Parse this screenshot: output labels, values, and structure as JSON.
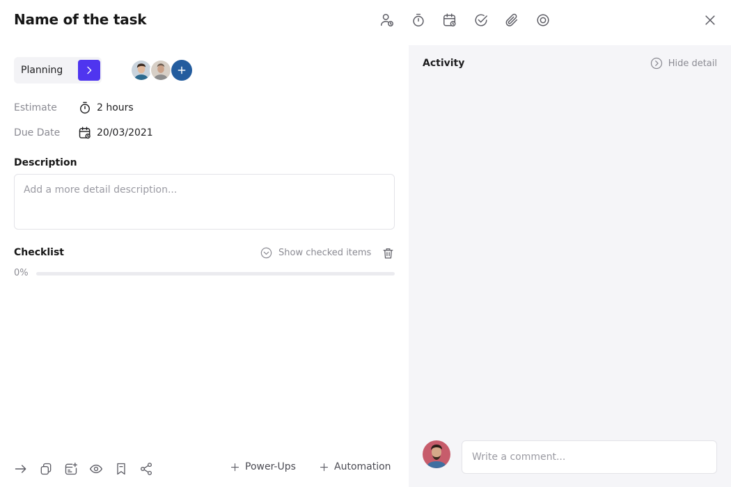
{
  "task": {
    "title": "Name of the task"
  },
  "header": {
    "icons": [
      "assign-user-icon",
      "timer-icon",
      "calendar-icon",
      "check-circle-icon",
      "paperclip-icon",
      "target-icon"
    ],
    "close": "close-icon"
  },
  "status": {
    "label": "Planning"
  },
  "fields": {
    "estimate": {
      "label": "Estimate",
      "value": "2 hours"
    },
    "due_date": {
      "label": "Due Date",
      "value": "20/03/2021"
    }
  },
  "description": {
    "title": "Description",
    "placeholder": "Add a more detail description..."
  },
  "checklist": {
    "title": "Checklist",
    "show_checked": "Show checked items",
    "progress_text": "0%",
    "progress": 0
  },
  "footer": {
    "icons": [
      "arrow-right-icon",
      "copy-icon",
      "card-add-icon",
      "eye-icon",
      "bookmark-icon",
      "share-icon"
    ],
    "power_ups": "Power-Ups",
    "automation": "Automation"
  },
  "activity": {
    "title": "Activity",
    "hide_detail": "Hide detail",
    "comment_placeholder": "Write a comment..."
  },
  "colors": {
    "accent": "#4f35ef",
    "add_member": "#235c9e",
    "panel_bg": "#f5f5f8"
  }
}
